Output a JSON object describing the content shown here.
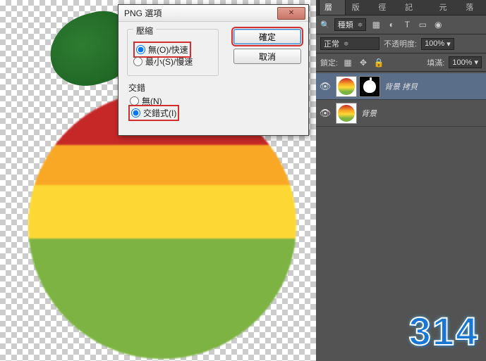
{
  "dialog": {
    "title": "PNG 選項",
    "close_glyph": "✕",
    "compression": {
      "legend": "壓縮",
      "opt_none": "無(O)/快速",
      "opt_smallest": "最小(S)/慢速"
    },
    "interlace": {
      "legend": "交錯",
      "opt_none": "無(N)",
      "opt_interlaced": "交錯式(I)"
    },
    "buttons": {
      "ok": "確定",
      "cancel": "取消"
    }
  },
  "panel": {
    "tabs": [
      "圖層",
      "色版",
      "路徑",
      "步驟記",
      "字元",
      "段落"
    ],
    "active_tab": 0,
    "search_glyph": "🔍",
    "kind_label": "種類",
    "icons": {
      "image": "▦",
      "adjust": "◐",
      "type": "T",
      "shape": "▭",
      "smart": "◉"
    },
    "blend_mode": "正常",
    "opacity_label": "不透明度:",
    "opacity_value": "100%",
    "lock_label": "鎖定:",
    "lock_icons": {
      "pixels": "▦",
      "position": "✥",
      "all": "🔒"
    },
    "fill_label": "填滿:",
    "fill_value": "100%"
  },
  "layers": [
    {
      "name": "背景 拷貝",
      "has_mask": true
    },
    {
      "name": "背景",
      "has_mask": false
    }
  ],
  "watermark": "314"
}
